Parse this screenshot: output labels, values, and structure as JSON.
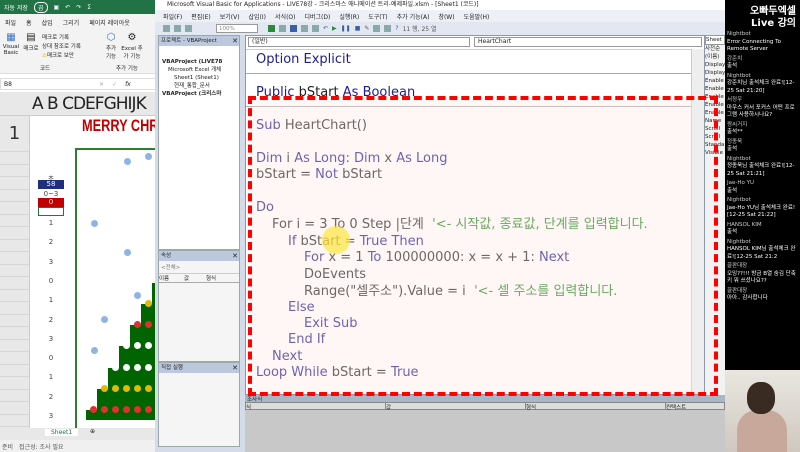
{
  "excel": {
    "qat": {
      "autosave": "자동 저장",
      "toggle": "끔"
    },
    "tabs": [
      "파일",
      "홈",
      "삽입",
      "그리기",
      "페이지 레이아웃"
    ],
    "ribbon": {
      "visual_basic": "Visual Basic",
      "macro": "매크로",
      "record": "매크로 기록",
      "relative": "상대 참조로 기록",
      "security": "매크로 보안",
      "group_code": "코드",
      "addins": "추가 기능",
      "excel_addins": "Excel 추가 기능",
      "group_addins": "추가 기능"
    },
    "name_box": "B8",
    "columns": "A B CDEFGHIJK",
    "row1": "1",
    "title": "MERRY CHRI",
    "label_count": "초",
    "count": "58",
    "label_range": "0~3",
    "value": "0",
    "numbers": [
      "1",
      "2",
      "3",
      "0",
      "1",
      "2",
      "3",
      "0",
      "1",
      "2",
      "3"
    ],
    "sheet_tab": "Sheet1",
    "status": {
      "ready": "준비",
      "accessibility": "접근성: 조사 필요"
    }
  },
  "vbe": {
    "title": "Microsoft Visual Basic for Applications - LIVE78강 - 크리스마스 애니메이션 트리-예제파일.xlsm - [Sheet1 (코드)]",
    "menu": [
      "파일(F)",
      "편집(E)",
      "보기(V)",
      "삽입(I)",
      "서식(O)",
      "디버그(D)",
      "실행(R)",
      "도구(T)",
      "추가 기능(A)",
      "창(W)",
      "도움말(H)"
    ],
    "zoom": "100%",
    "cursor_pos": "11 행, 25 열",
    "project": {
      "title": "프로젝트 - VBAProject",
      "items": [
        "VBAProject (LIVE78",
        "Microsoft Excel 개체",
        "Sheet1 (Sheet1)",
        "현재_통합_문서",
        "VBAProject (크리스마"
      ]
    },
    "properties": {
      "title": "속성",
      "object": "<전체>",
      "cols": [
        "이름",
        "값",
        "형식"
      ]
    },
    "immediate": {
      "title": "직접 실행"
    },
    "object_combo": "(일반)",
    "proc_combo": "HeartChart",
    "code": {
      "l1": "Option Explicit",
      "l2a": "Public",
      "l2b": " bStart ",
      "l2c": "As Boolean",
      "l3a": "Sub",
      "l3b": " HeartChart()",
      "l4a": "Dim",
      "l4b": " i ",
      "l4c": "As Long",
      "l4d": ": ",
      "l4e": "Dim",
      "l4f": " x ",
      "l4g": "As Long",
      "l5a": "bStart = ",
      "l5b": "Not",
      "l5c": " bStart",
      "l6": "Do",
      "l7a": "For i = 3 To 0 Step |단계  ",
      "l7b": "'<- 시작값, 종료값, 단계를 입력합니다.",
      "l8a": "If",
      "l8b": " bStart = ",
      "l8c": "True Then",
      "l9a": "For",
      "l9b": " x = 1 ",
      "l9c": "To",
      "l9d": " 100000000: x = x + 1: ",
      "l9e": "Next",
      "l10": "DoEvents",
      "l11a": "Range(\"셀주소\").Value = i  ",
      "l11b": "'<- 셀 주소를 입력합니다.",
      "l12": "Else",
      "l13": "Exit Sub",
      "l14": "End If",
      "l15": "Next",
      "l16a": "Loop While",
      "l16b": " bStart = ",
      "l16c": "True"
    },
    "watch": {
      "title": "조사식",
      "cols": [
        "식",
        "값",
        "형식",
        "컨텍스트"
      ]
    },
    "props_right": {
      "combo": "Sheet",
      "tab": "사전순",
      "items": [
        "(이름)",
        "Display",
        "Display",
        "Enable",
        "Enable",
        "Enable",
        "Enable",
        "Enable",
        "Name",
        "Scroll",
        "Scroll",
        "Standa",
        "Visible"
      ]
    }
  },
  "chat": {
    "title1": "오빠두엑셀",
    "title2": "Live 강의",
    "messages": [
      {
        "name": "Nightbot",
        "text": "Error Connecting To Remote Server"
      },
      {
        "name": "강준치",
        "text": "출석"
      },
      {
        "name": "Nightbot",
        "text": "강준치님 출석체크 완료![12-25 Sat 21:20]"
      },
      {
        "name": "서정우",
        "text": "마우스 커서 포커스 어떤 프로그램 사용하시나요?"
      },
      {
        "name": "짱씨거지",
        "text": "출석**"
      },
      {
        "name": "정종욱",
        "text": "출석"
      },
      {
        "name": "Nightbot",
        "text": "정종욱님 출석체크 완료![12-25 Sat 21:21]"
      },
      {
        "name": "Jae-Ho YU",
        "text": "출석"
      },
      {
        "name": "Nightbot",
        "text": "Jae-Ho YU님 출석체크 완료![12-25 Sat 21:22]"
      },
      {
        "name": "HANSOL KIM",
        "text": "출석"
      },
      {
        "name": "Nightbot",
        "text": "HANSOL KIM님 출석체크 완료![12-25 Sat 21:2"
      },
      {
        "name": "끌판대장",
        "text": "오잉??!!! 방금 B열 숨김 단축키 뭐 쓰셨나요??"
      },
      {
        "name": "끌판대장",
        "text": "아아.. 감사합니다"
      }
    ]
  }
}
